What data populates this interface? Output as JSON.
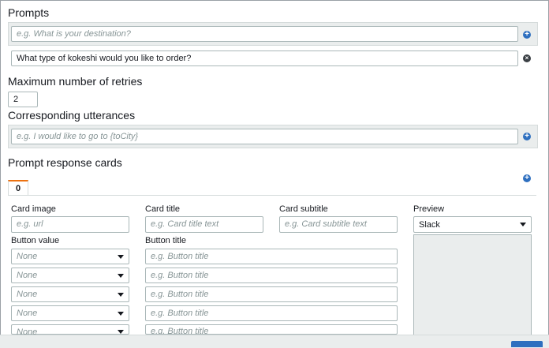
{
  "prompts": {
    "title": "Prompts",
    "new_prompt_placeholder": "e.g. What is your destination?",
    "existing_prompt": "What type of kokeshi would you like to order?"
  },
  "retries": {
    "title": "Maximum number of retries",
    "value": "2"
  },
  "utterances": {
    "title": "Corresponding utterances",
    "placeholder": "e.g. I would like to go to {toCity}"
  },
  "response_cards": {
    "title": "Prompt response cards",
    "tab_label": "0",
    "card_image_label": "Card image",
    "card_image_placeholder": "e.g. url",
    "card_title_label": "Card title",
    "card_title_placeholder": "e.g. Card title text",
    "card_subtitle_label": "Card subtitle",
    "card_subtitle_placeholder": "e.g. Card subtitle text",
    "preview_label": "Preview",
    "preview_value": "Slack",
    "button_value_label": "Button value",
    "button_title_label": "Button title",
    "buttons": [
      {
        "value": "None",
        "title_placeholder": "e.g. Button title"
      },
      {
        "value": "None",
        "title_placeholder": "e.g. Button title"
      },
      {
        "value": "None",
        "title_placeholder": "e.g. Button title"
      },
      {
        "value": "None",
        "title_placeholder": "e.g. Button title"
      },
      {
        "value": "None",
        "title_placeholder": "e.g. Button title"
      }
    ]
  },
  "icons": {
    "add": "plus-circle-icon",
    "remove": "x-circle-icon",
    "dropdown": "chevron-down-icon"
  },
  "colors": {
    "accent_blue": "#2e6fbf",
    "tab_accent": "#ec7211",
    "band_gray": "#eaeded"
  }
}
